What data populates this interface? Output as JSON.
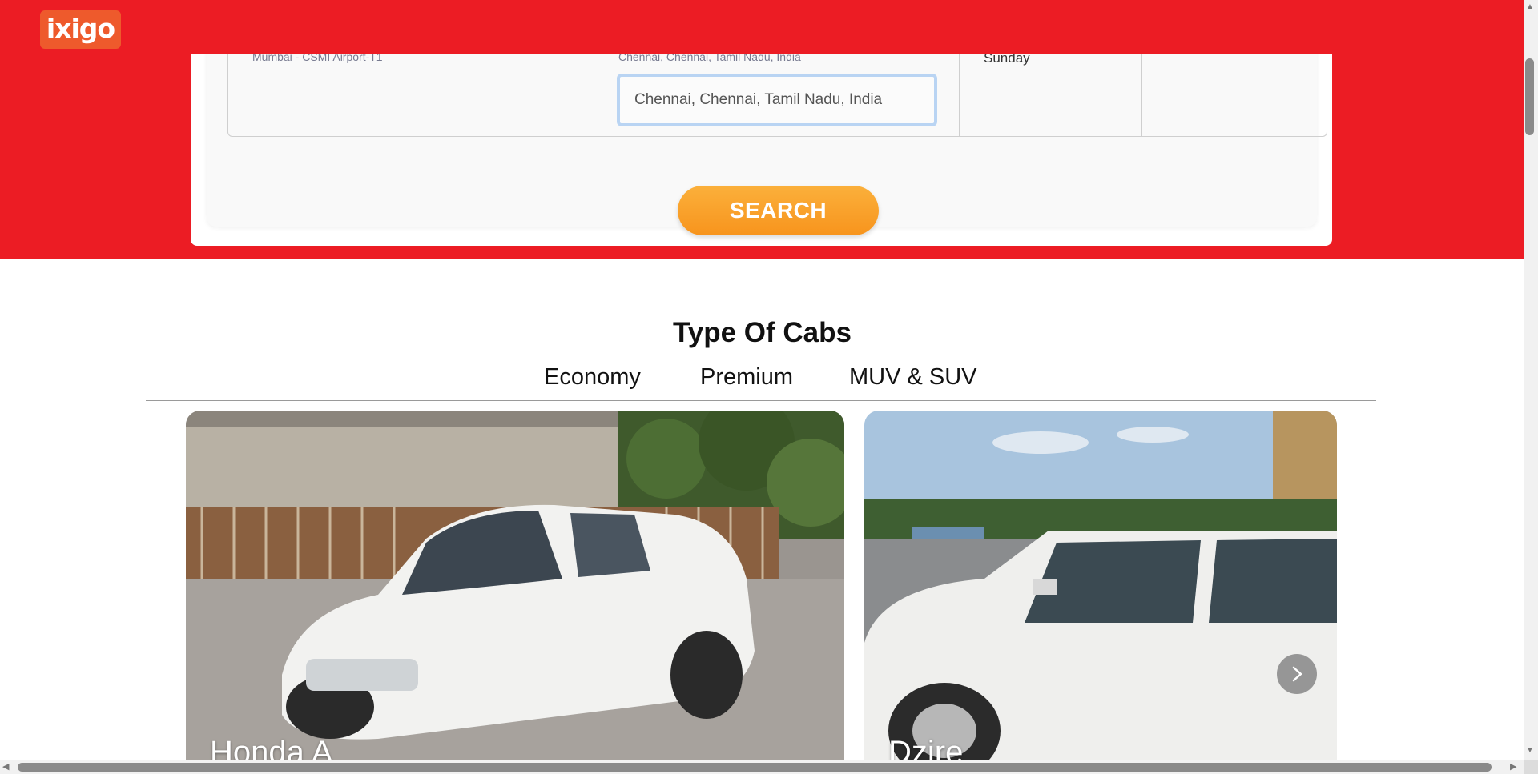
{
  "header": {
    "logo_text": "ixigo",
    "brand_color": "#ec1c24",
    "logo_color": "#ee5a2c"
  },
  "search": {
    "from_subtext": "Mumbai - CSMI Airport-T1",
    "to_subtext": "Chennai, Chennai, Tamil Nadu, India",
    "to_value": "Chennai, Chennai, Tamil Nadu, India",
    "date_day": "Sunday",
    "search_label": "SEARCH",
    "search_color": "#f7941d"
  },
  "cabs": {
    "title": "Type Of Cabs",
    "tabs": [
      {
        "label": "Economy"
      },
      {
        "label": "Premium"
      },
      {
        "label": "MUV & SUV"
      }
    ],
    "cards": [
      {
        "caption": "Honda A",
        "image": "white-sedan-photo"
      },
      {
        "caption": "Dzire",
        "image": "white-sedan-side-photo"
      }
    ],
    "next_icon": "chevron-right-icon"
  }
}
